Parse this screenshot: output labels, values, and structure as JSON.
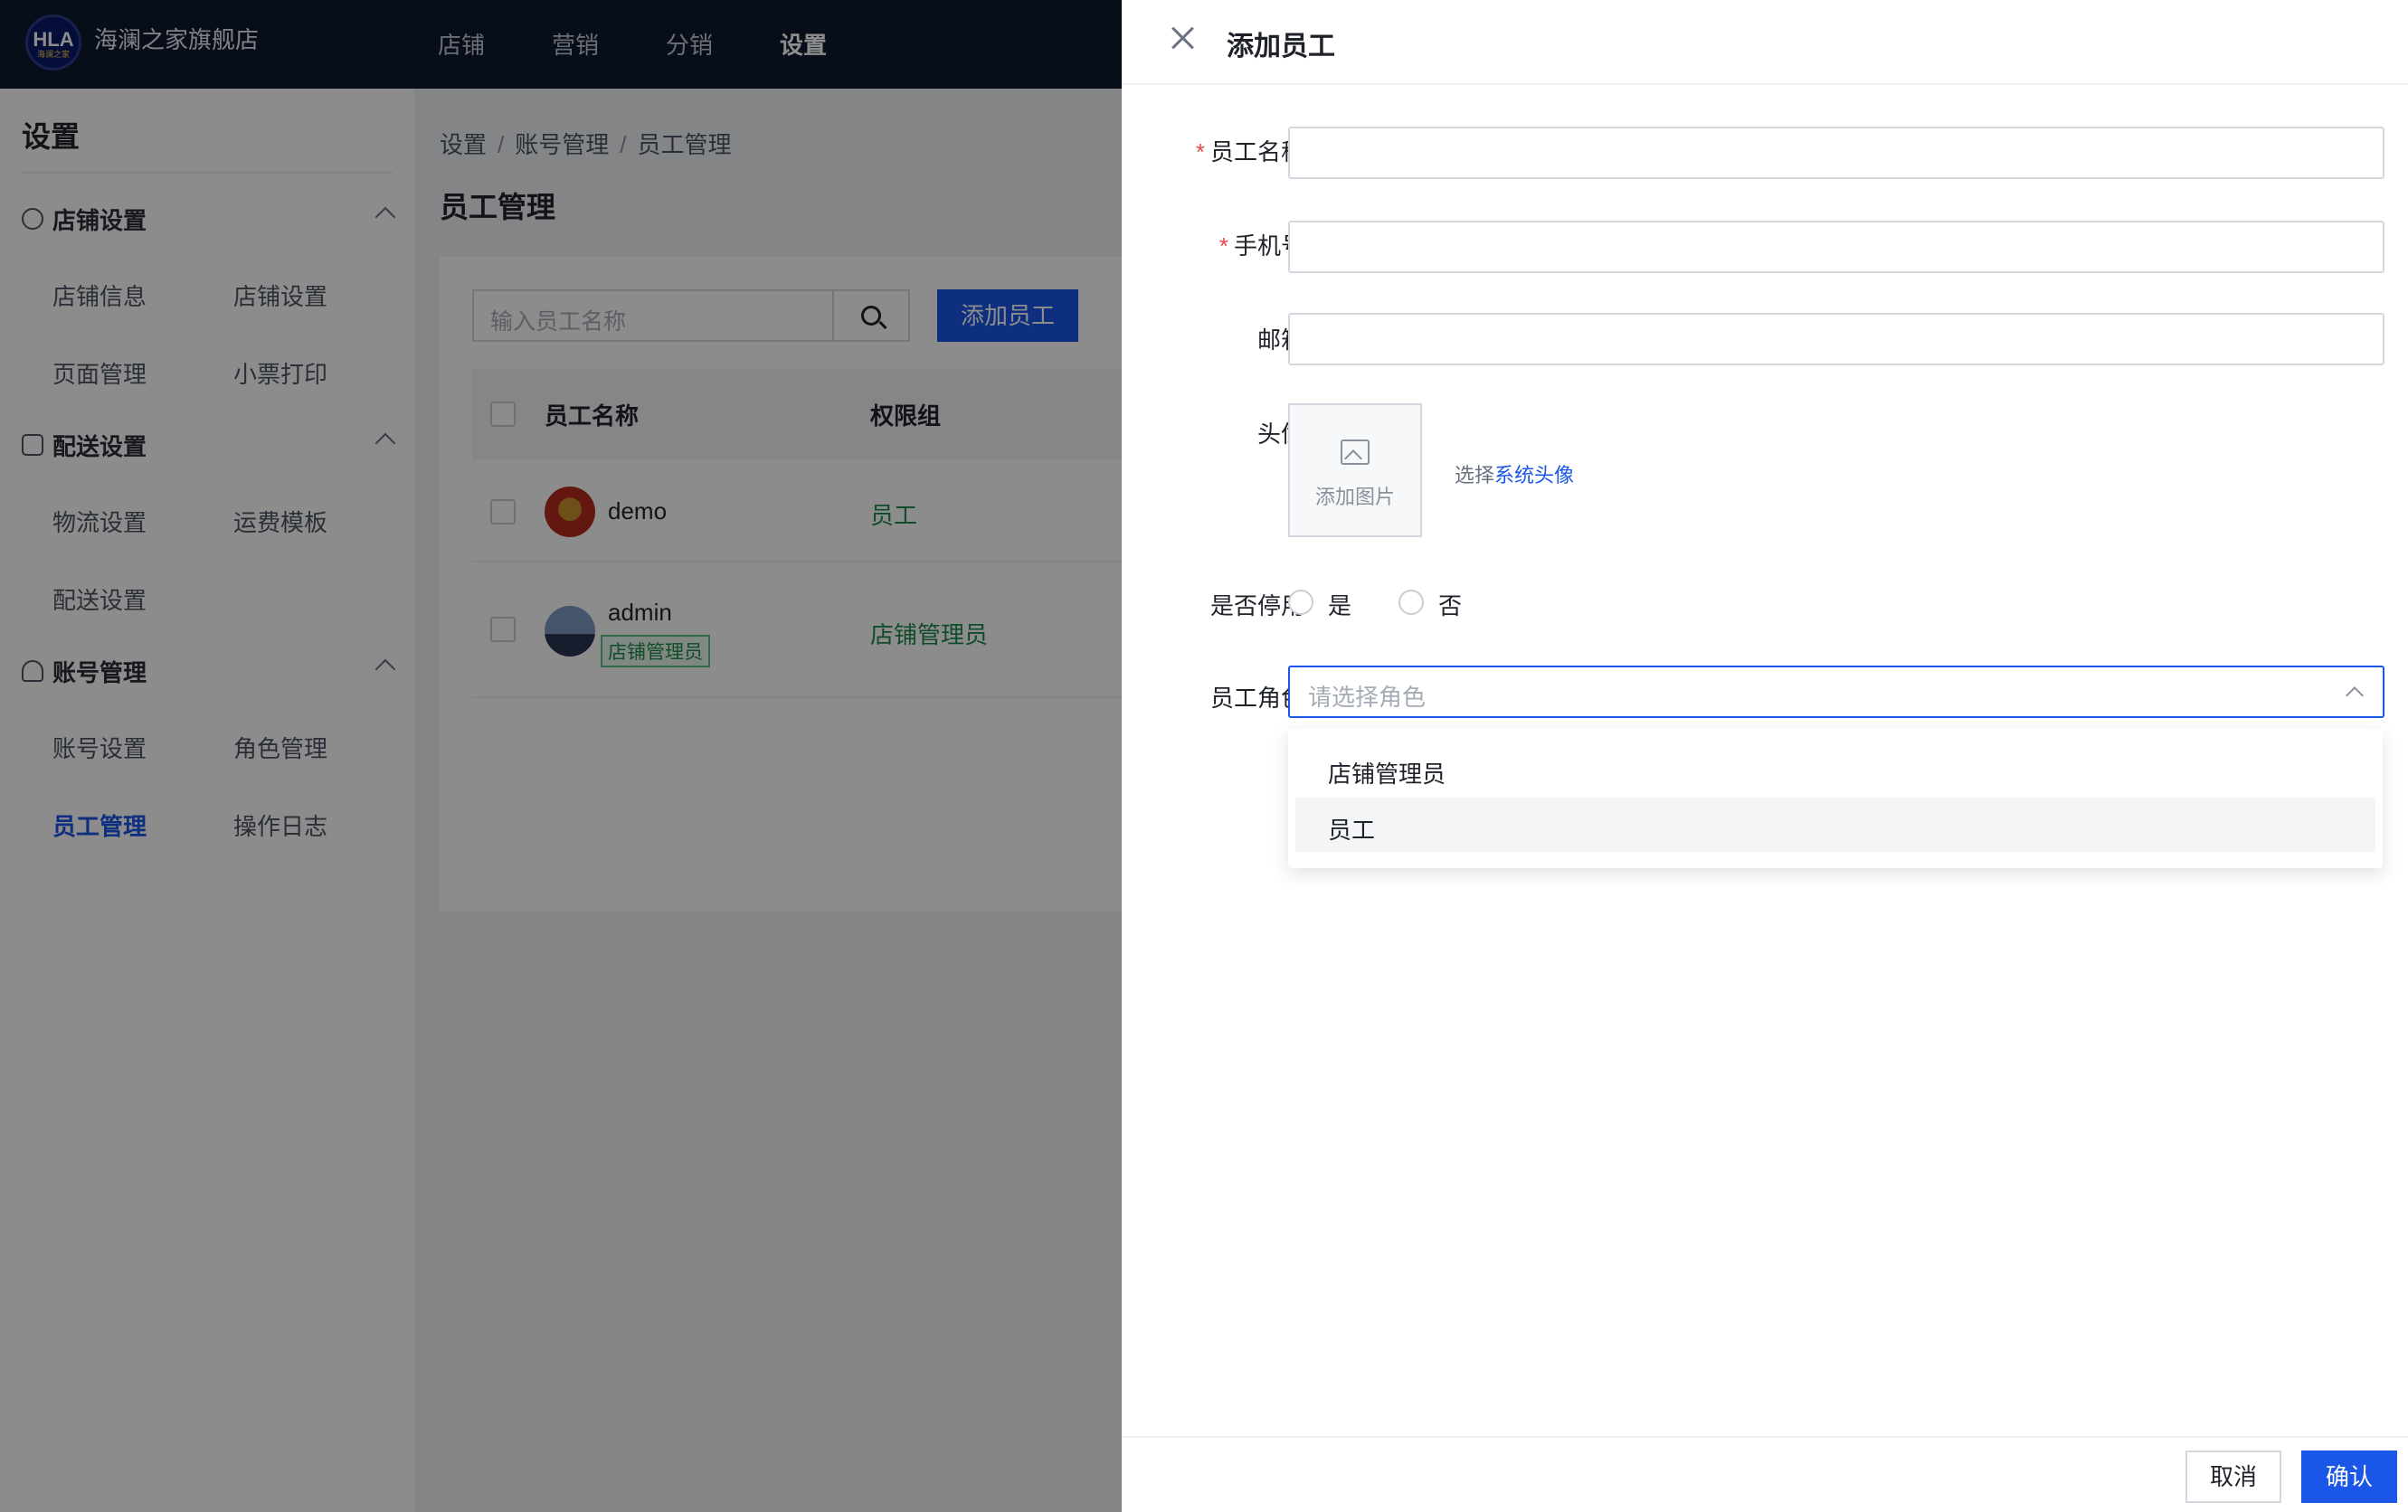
{
  "app": {
    "logo_text": "HLA",
    "logo_subtext": "海澜之家",
    "shop_name": "海澜之家旗舰店",
    "nav": [
      "店铺",
      "营销",
      "分销",
      "设置"
    ],
    "active_nav": "设置"
  },
  "sidebar": {
    "title": "设置",
    "groups": [
      {
        "label": "店铺设置",
        "icon": "gear-icon",
        "items": [
          "店铺信息",
          "店铺设置",
          "页面管理",
          "小票打印"
        ]
      },
      {
        "label": "配送设置",
        "icon": "card-icon",
        "items": [
          "物流设置",
          "运费模板",
          "配送设置"
        ]
      },
      {
        "label": "账号管理",
        "icon": "user-icon",
        "items": [
          "账号设置",
          "角色管理",
          "员工管理",
          "操作日志"
        ]
      }
    ],
    "active_item": "员工管理"
  },
  "main": {
    "breadcrumb": [
      "设置",
      "账号管理",
      "员工管理"
    ],
    "title": "员工管理",
    "search_placeholder": "输入员工名称",
    "add_button": "添加员工",
    "columns": [
      "员工名称",
      "权限组"
    ],
    "rows": [
      {
        "name": "demo",
        "tag": "",
        "group": "员工"
      },
      {
        "name": "admin",
        "tag": "店铺管理员",
        "group": "店铺管理员"
      }
    ]
  },
  "drawer": {
    "title": "添加员工",
    "fields": {
      "name_label": "员工名称",
      "phone_label": "手机号",
      "email_label": "邮箱",
      "avatar_label": "头像",
      "upload_label": "添加图片",
      "pick_prefix": "选择",
      "pick_link": "系统头像",
      "disable_label": "是否停用",
      "yes": "是",
      "no": "否",
      "role_label": "员工角色",
      "role_placeholder": "请选择角色"
    },
    "role_options": [
      "店铺管理员",
      "员工"
    ],
    "cancel": "取消",
    "confirm": "确认"
  },
  "colors": {
    "primary": "#1a56e8",
    "success": "#1f8a4c",
    "required": "#e5484d",
    "topbar": "#0f1a2e"
  }
}
